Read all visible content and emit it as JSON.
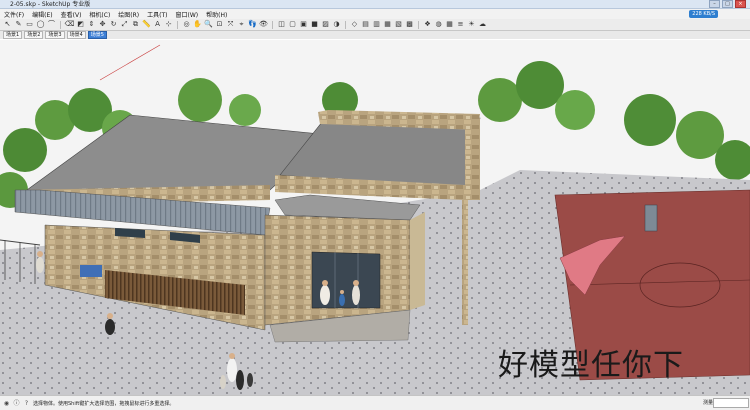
{
  "window": {
    "title": "2-05.skp - SketchUp 专业版"
  },
  "menu": [
    "文件(F)",
    "编辑(E)",
    "查看(V)",
    "相机(C)",
    "绘图(R)",
    "工具(T)",
    "窗口(W)",
    "帮助(H)"
  ],
  "badge": "228 KB/S",
  "scenes": [
    "场景1",
    "场景2",
    "场景3",
    "场景4",
    "场景5"
  ],
  "status": {
    "text": "选择物体。使用Shift键扩大选择范围，拖拽鼠标进行多重选择。",
    "measure_label": "测量"
  },
  "watermark": "好模型任你下",
  "toolbar_icons": [
    "select-icon",
    "pencil-icon",
    "rectangle-icon",
    "circle-icon",
    "arc-icon",
    "eraser-icon",
    "paint-bucket-icon",
    "push-pull-icon",
    "move-icon",
    "rotate-icon",
    "scale-icon",
    "offset-icon",
    "tape-measure-icon",
    "text-icon",
    "axes-icon",
    "orbit-icon",
    "pan-icon",
    "zoom-icon",
    "zoom-window-icon",
    "zoom-extents-icon",
    "camera-position-icon",
    "walk-icon",
    "look-around-icon",
    "section-plane-icon",
    "wireframe-icon",
    "hidden-line-icon",
    "shaded-icon",
    "textured-icon",
    "monochrome-icon",
    "iso-view-icon",
    "top-view-icon",
    "front-view-icon",
    "right-view-icon",
    "back-view-icon",
    "left-view-icon",
    "components-icon",
    "materials-icon",
    "styles-icon",
    "layers-icon",
    "shadows-icon",
    "fog-icon"
  ]
}
